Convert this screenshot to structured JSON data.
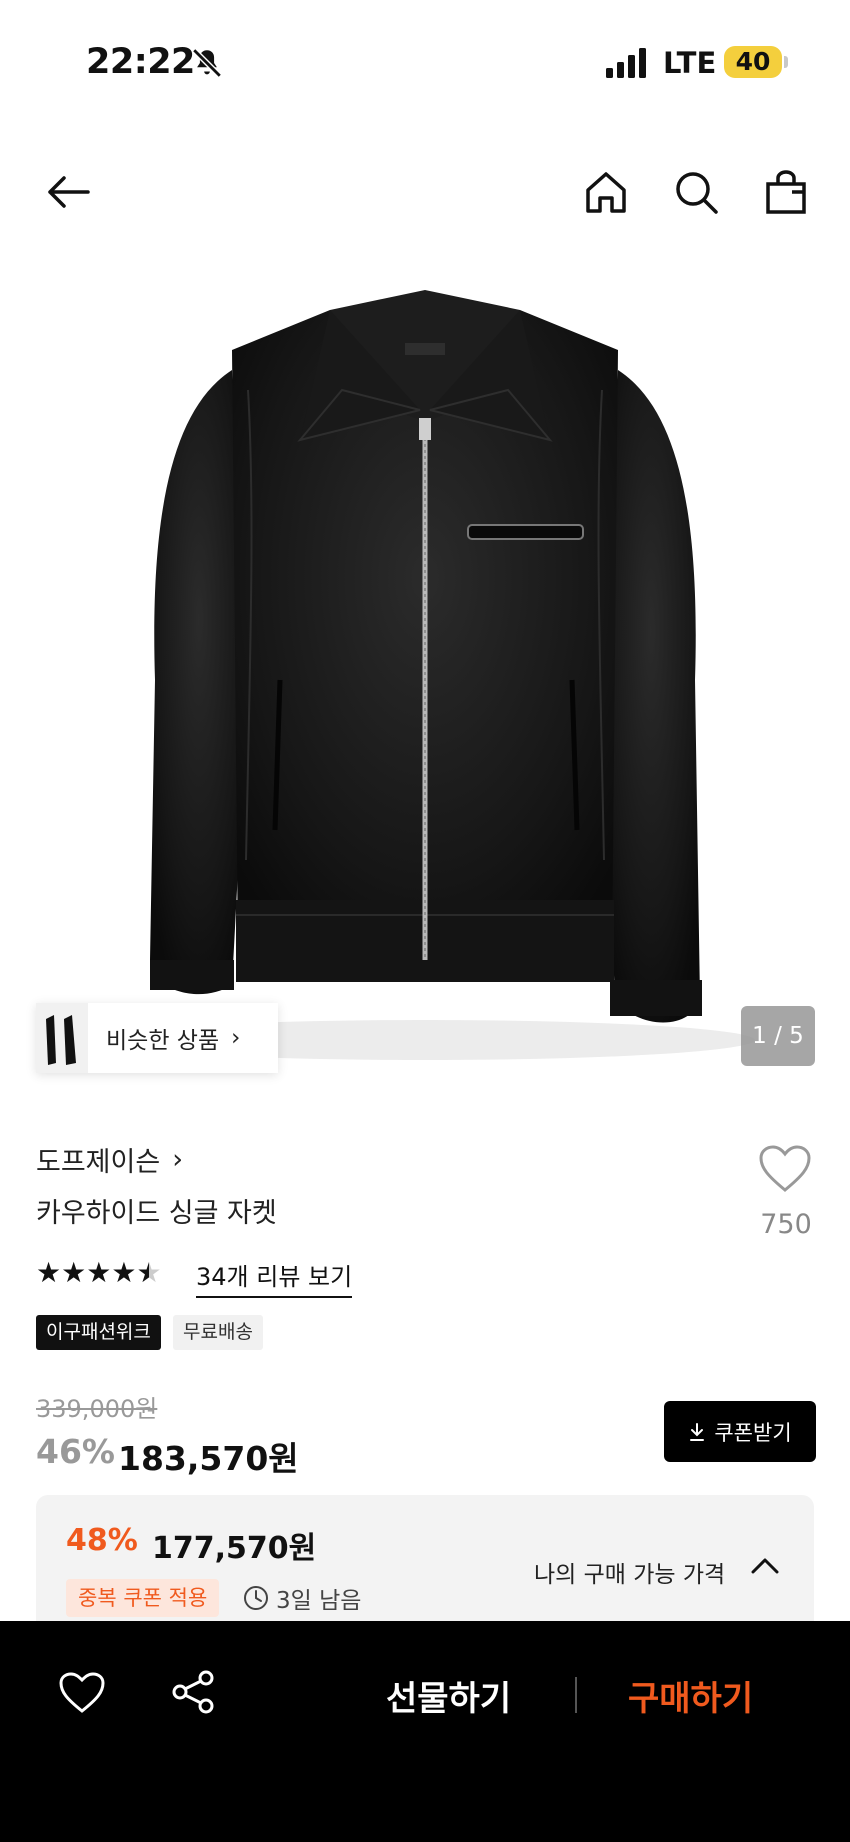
{
  "status_bar": {
    "time": "22:22",
    "network": "LTE",
    "battery": "40"
  },
  "nav": {
    "icons": [
      "back-arrow-icon",
      "home-icon",
      "search-icon",
      "shopping-bag-icon"
    ]
  },
  "gallery": {
    "similar_label": "비슷한 상품",
    "counter": "1 / 5"
  },
  "product": {
    "brand": "도프제이슨",
    "title": "카우하이드 싱글 자켓",
    "wish_count": "750",
    "rating": 4.5,
    "review_link": "34개 리뷰 보기",
    "tags": [
      "이구패션위크",
      "무료배송"
    ]
  },
  "price": {
    "original": "339,000원",
    "discount_rate": "46%",
    "sale": "183,570원",
    "coupon_button": "쿠폰받기"
  },
  "my_price": {
    "rate": "48%",
    "price": "177,570원",
    "label": "나의 구매 가능 가격",
    "badge": "중복 쿠폰 적용",
    "time_left": "3일 남음"
  },
  "bottom_bar": {
    "gift": "선물하기",
    "buy": "구매하기"
  },
  "colors": {
    "accent": "#f05a1e",
    "battery": "#f4cf3d",
    "bar_bg": "#000000"
  }
}
